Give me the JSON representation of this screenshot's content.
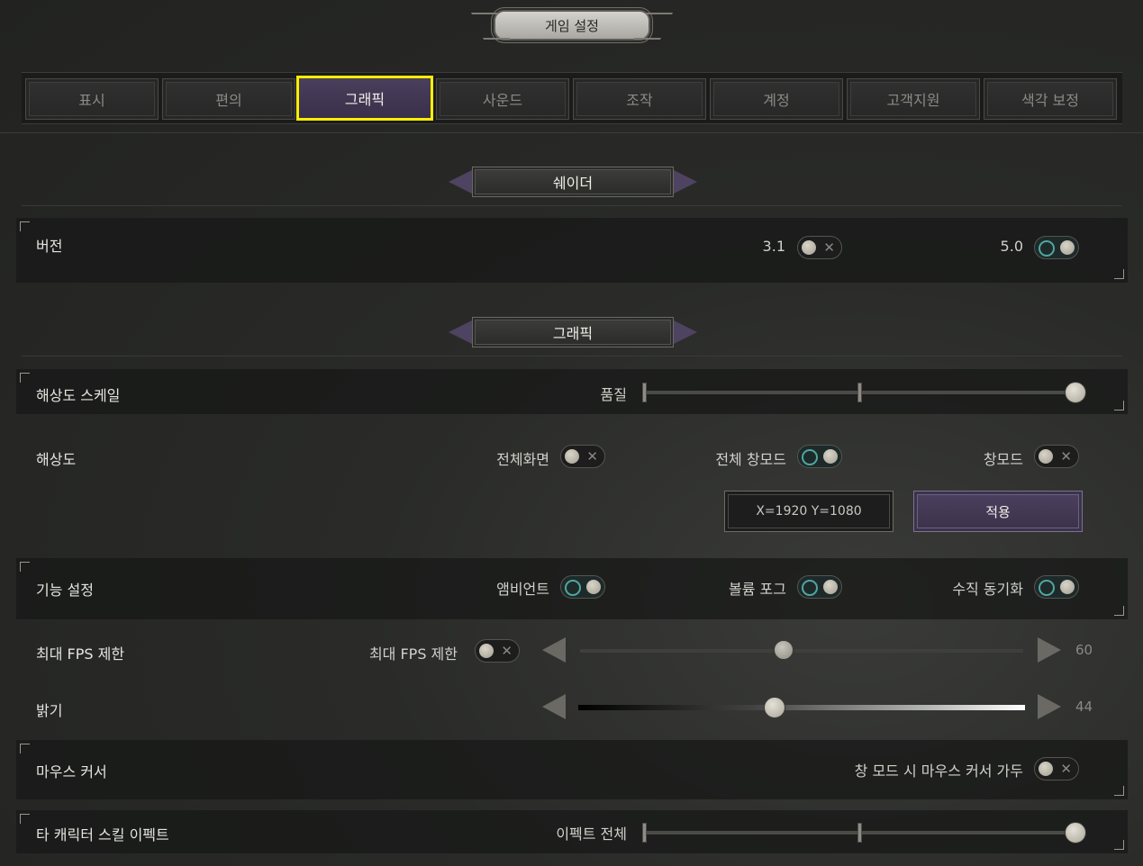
{
  "window": {
    "title": "게임 설정"
  },
  "tabs": [
    {
      "label": "표시"
    },
    {
      "label": "편의"
    },
    {
      "label": "그래픽",
      "active": true
    },
    {
      "label": "사운드"
    },
    {
      "label": "조작"
    },
    {
      "label": "계정"
    },
    {
      "label": "고객지원"
    },
    {
      "label": "색각 보정"
    }
  ],
  "colors": {
    "accent_highlight": "#ffee00",
    "accent_purple": "#4a3f5c",
    "toggle_on_ring": "#4fa7a0"
  },
  "shader": {
    "heading": "쉐이더",
    "version": {
      "label": "버전",
      "opt1": "3.1",
      "opt1_on": false,
      "opt2": "5.0",
      "opt2_on": true
    }
  },
  "graphics": {
    "heading": "그래픽",
    "resolution_scale": {
      "label": "해상도 스케일",
      "mode_label": "품질",
      "level": "max"
    },
    "resolution": {
      "label": "해상도",
      "fullscreen": "전체화면",
      "fullscreen_on": false,
      "borderless": "전체 창모드",
      "borderless_on": true,
      "windowed": "창모드",
      "windowed_on": false,
      "current_value": "X=1920 Y=1080",
      "apply_label": "적용"
    },
    "features": {
      "label": "기능 설정",
      "ambient": "앰비언트",
      "ambient_on": true,
      "volume_fog": "볼륨 포그",
      "volume_fog_on": true,
      "vsync": "수직 동기화",
      "vsync_on": true
    },
    "fps_limit": {
      "label": "최대 FPS 제한",
      "toggle_label": "최대 FPS 제한",
      "toggle_on": false,
      "value": "60",
      "fraction": 0.46
    },
    "brightness": {
      "label": "밝기",
      "value": "44",
      "fraction": 0.44
    },
    "mouse_cursor": {
      "label": "마우스 커서",
      "option": "창 모드 시 마우스 커서 가두",
      "on": false
    },
    "other_skill_effects": {
      "label": "타 캐릭터 스킬 이펙트",
      "mode_label": "이펙트 전체",
      "level": "max"
    }
  }
}
